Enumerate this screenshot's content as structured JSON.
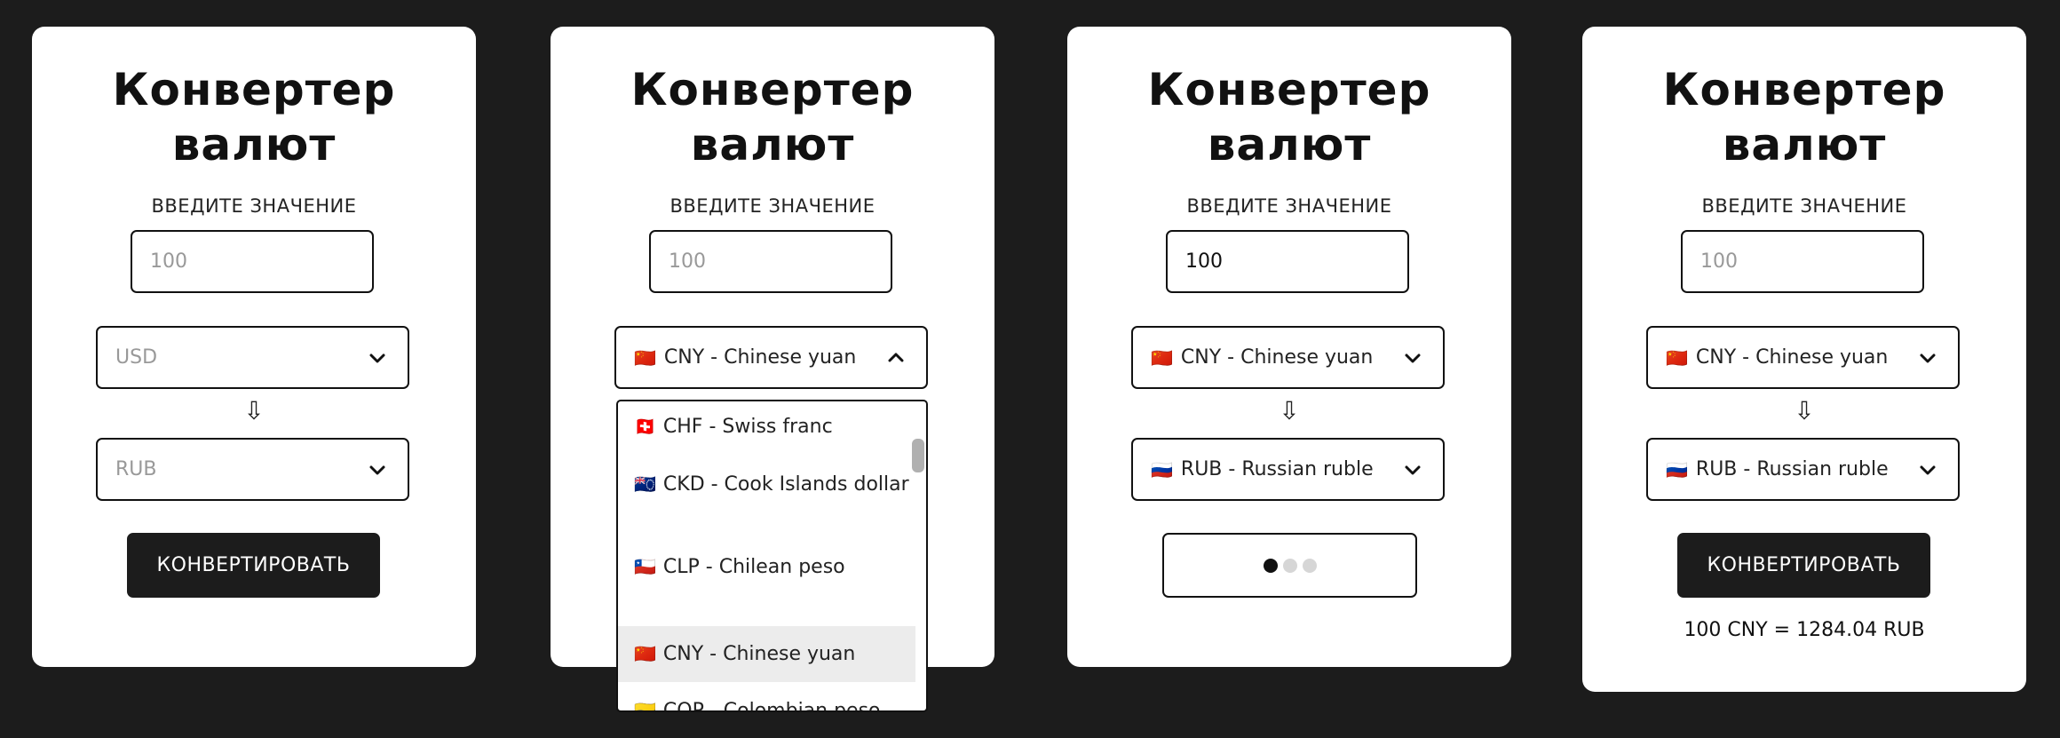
{
  "colors": {
    "background": "#1c1c1c",
    "card": "#ffffff",
    "button": "#1c1c1c",
    "highlight": "#ececec"
  },
  "cards": [
    {
      "title_line1": "Конвертер",
      "title_line2": "валют",
      "input_label": "ВВЕДИТЕ ЗНАЧЕНИЕ",
      "amount_placeholder": "100",
      "from": {
        "flag": "",
        "text": "USD"
      },
      "arrow": "⇩",
      "to": {
        "flag": "",
        "text": "RUB"
      },
      "button_label": "КОНВЕРТИРОВАТЬ"
    },
    {
      "title_line1": "Конвертер",
      "title_line2": "валют",
      "input_label": "ВВЕДИТЕ ЗНАЧЕНИЕ",
      "amount_placeholder": "100",
      "from": {
        "flag": "🇨🇳",
        "text": "CNY - Chinese yuan"
      },
      "dropdown_options": [
        {
          "flag": "🇨🇭",
          "text": "CHF - Swiss franc"
        },
        {
          "flag": "🇨🇰",
          "text": "CKD - Cook Islands dollar"
        },
        {
          "flag": "🇨🇱",
          "text": "CLP - Chilean peso"
        },
        {
          "flag": "🇨🇳",
          "text": "CNY - Chinese yuan",
          "selected": true
        },
        {
          "flag": "🇨🇴",
          "text": "COP - Colombian peso"
        }
      ]
    },
    {
      "title_line1": "Конвертер",
      "title_line2": "валют",
      "input_label": "ВВЕДИТЕ ЗНАЧЕНИЕ",
      "amount_value": "100",
      "from": {
        "flag": "🇨🇳",
        "text": "CNY - Chinese yuan"
      },
      "arrow": "⇩",
      "to": {
        "flag": "🇷🇺",
        "text": "RUB - Russian ruble"
      },
      "loading_dots": [
        "#111111",
        "#d6d6d6",
        "#d6d6d6"
      ]
    },
    {
      "title_line1": "Конвертер",
      "title_line2": "валют",
      "input_label": "ВВЕДИТЕ ЗНАЧЕНИЕ",
      "amount_placeholder": "100",
      "from": {
        "flag": "🇨🇳",
        "text": "CNY - Chinese yuan"
      },
      "arrow": "⇩",
      "to": {
        "flag": "🇷🇺",
        "text": "RUB - Russian ruble"
      },
      "button_label": "КОНВЕРТИРОВАТЬ",
      "result": "100 CNY = 1284.04 RUB"
    }
  ]
}
